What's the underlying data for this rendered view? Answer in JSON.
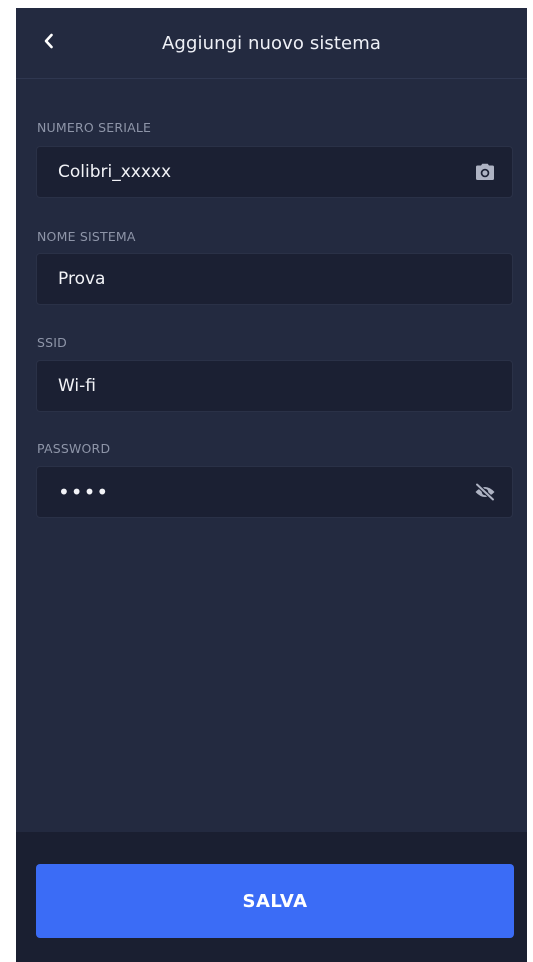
{
  "header": {
    "title": "Aggiungi nuovo sistema",
    "back_icon": "chevron-left-icon"
  },
  "form": {
    "serial": {
      "label": "NUMERO SERIALE",
      "value": "Colibri_xxxxx",
      "icon": "camera-icon"
    },
    "system_name": {
      "label": "NOME SISTEMA",
      "value": "Prova"
    },
    "ssid": {
      "label": "SSID",
      "value": "Wi-fi"
    },
    "password": {
      "label": "PASSWORD",
      "value": "••••",
      "icon": "eye-off-icon"
    }
  },
  "footer": {
    "save_label": "SALVA"
  },
  "colors": {
    "background": "#232a40",
    "field_background": "#1b2033",
    "bottom_bar": "#1a1f31",
    "accent": "#3b6cf6",
    "label": "#8e95a8",
    "text": "#f2f3f7"
  }
}
